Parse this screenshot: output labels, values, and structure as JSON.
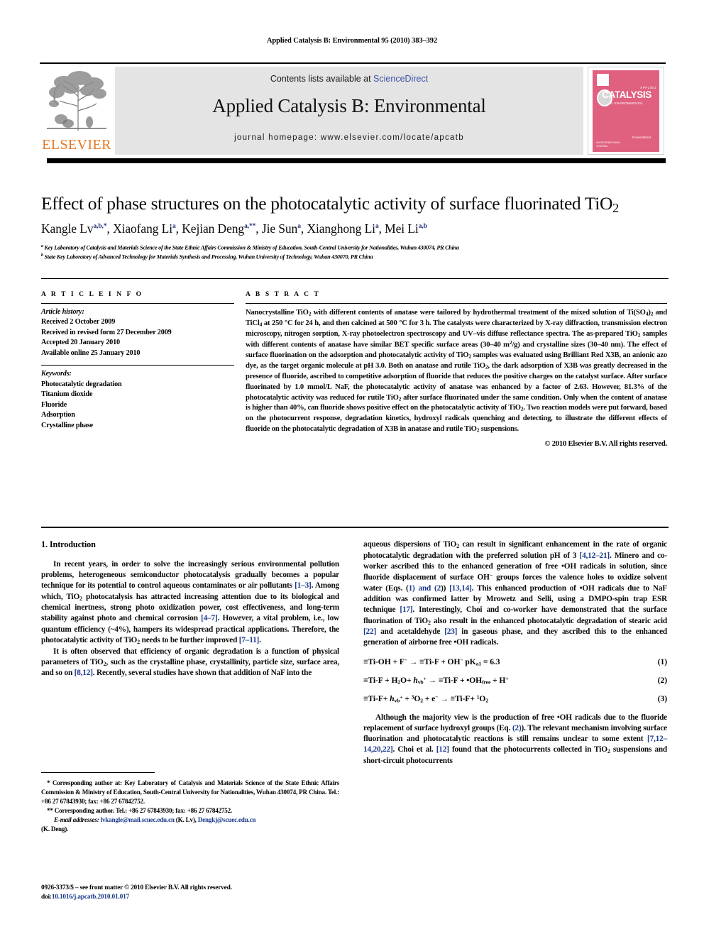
{
  "running_head": "Applied Catalysis B: Environmental 95 (2010) 383–392",
  "masthead": {
    "contents_prefix": "Contents lists available at ",
    "sciencedirect": "ScienceDirect",
    "journal_title": "Applied Catalysis B: Environmental",
    "homepage": "journal homepage: www.elsevier.com/locate/apcatb",
    "publisher_wordmark": "ELSEVIER",
    "cover": {
      "kicker": "APPLIED",
      "title": "CATALYSIS",
      "subtitle": "B: ENVIRONMENTAL",
      "footer": "AN INTERNATIONAL JOURNAL",
      "sd_logo": "ScienceDirect"
    }
  },
  "article": {
    "title": "Effect of phase structures on the photocatalytic activity of surface fluorinated TiO",
    "title_sub": "2",
    "authors": [
      {
        "name": "Kangle Lv",
        "marks": "a,b,*"
      },
      {
        "name": "Xiaofang Li",
        "marks": "a"
      },
      {
        "name": "Kejian Deng",
        "marks": "a,**"
      },
      {
        "name": "Jie Sun",
        "marks": "a"
      },
      {
        "name": "Xianghong Li",
        "marks": "a"
      },
      {
        "name": "Mei Li",
        "marks": "a,b"
      }
    ],
    "affiliations": [
      {
        "mark": "a",
        "text": "Key Laboratory of Catalysis and Materials Science of the State Ethnic Affairs Commission & Ministry of Education, South-Central University for Nationalities, Wuhan 430074, PR China"
      },
      {
        "mark": "b",
        "text": "State Key Laboratory of Advanced Technology for Materials Synthesis and Processing, Wuhan University of Technology, Wuhan 430070, PR China"
      }
    ]
  },
  "article_info": {
    "heading": "A R T I C L E   I N F O",
    "history_label": "Article history:",
    "history": [
      "Received 2 October 2009",
      "Received in revised form 27 December 2009",
      "Accepted 20 January 2010",
      "Available online 25 January 2010"
    ],
    "keywords_label": "Keywords:",
    "keywords": [
      "Photocatalytic degradation",
      "Titanium dioxide",
      "Fluoride",
      "Adsorption",
      "Crystalline phase"
    ]
  },
  "abstract": {
    "heading": "A B S T R A C T",
    "text": "Nanocrystalline TiO2 with different contents of anatase were tailored by hydrothermal treatment of the mixed solution of Ti(SO4)2 and TiCl4 at 250 °C for 24 h, and then calcined at 500 °C for 3 h. The catalysts were characterized by X-ray diffraction, transmission electron microscopy, nitrogen sorption, X-ray photoelectron spectroscopy and UV–vis diffuse reflectance spectra. The as-prepared TiO2 samples with different contents of anatase have similar BET specific surface areas (30–40 m2/g) and crystalline sizes (30–40 nm). The effect of surface fluorination on the adsorption and photocatalytic activity of TiO2 samples was evaluated using Brilliant Red X3B, an anionic azo dye, as the target organic molecule at pH 3.0. Both on anatase and rutile TiO2, the dark adsorption of X3B was greatly decreased in the presence of fluoride, ascribed to competitive adsorption of fluoride that reduces the positive charges on the catalyst surface. After surface fluorinated by 1.0 mmol/L NaF, the photocatalytic activity of anatase was enhanced by a factor of 2.63. However, 81.3% of the photocatalytic activity was reduced for rutile TiO2 after surface fluorinated under the same condition. Only when the content of anatase is higher than 40%, can fluoride shows positive effect on the photocatalytic activity of TiO2. Two reaction models were put forward, based on the photocurrent response, degradation kinetics, hydroxyl radicals quenching and detecting, to illustrate the different effects of fluoride on the photocatalytic degradation of X3B in anatase and rutile TiO2 suspensions.",
    "copyright": "© 2010 Elsevier B.V. All rights reserved."
  },
  "body": {
    "section_heading": "1. Introduction",
    "left_paragraphs": [
      "In recent years, in order to solve the increasingly serious environmental pollution problems, heterogeneous semiconductor photocatalysis gradually becomes a popular technique for its potential to control aqueous contaminates or air pollutants [1–3]. Among which, TiO2 photocatalysis has attracted increasing attention due to its biological and chemical inertness, strong photo oxidization power, cost effectiveness, and long-term stability against photo and chemical corrosion [4–7]. However, a vital problem, i.e., low quantum efficiency (~4%), hampers its widespread practical applications. Therefore, the photocatalytic activity of TiO2 needs to be further improved [7–11].",
      "It is often observed that efficiency of organic degradation is a function of physical parameters of TiO2, such as the crystalline phase, crystallinity, particle size, surface area, and so on [8,12]. Recently, several studies have shown that addition of NaF into the"
    ],
    "right_paragraphs": [
      "aqueous dispersions of TiO2 can result in significant enhancement in the rate of organic photocatalytic degradation with the preferred solution pH of 3 [4,12–21]. Minero and co-worker ascribed this to the enhanced generation of free •OH radicals in solution, since fluoride displacement of surface OH− groups forces the valence holes to oxidize solvent water (Eqs. (1) and (2)) [13,14]. This enhanced production of •OH radicals due to NaF addition was confirmed latter by Mrowetz and Selli, using a DMPO-spin trap ESR technique [17]. Interestingly, Choi and co-worker have demonstrated that the surface fluorination of TiO2 also result in the enhanced photocatalytic degradation of stearic acid [22] and acetaldehyde [23] in gaseous phase, and they ascribed this to the enhanced generation of airborne free •OH radicals.",
      "Although the majority view is the production of free •OH radicals due to the fluoride replacement of surface hydroxyl groups (Eq. (2)). The relevant mechanism involving surface fluorination and photocatalytic reactions is still remains unclear to some extent [7,12–14,20,22]. Choi et al. [12] found that the photocurrents collected in TiO2 suspensions and short-circuit photocurrents"
    ],
    "equations": [
      {
        "number": "(1)",
        "text": "≡Ti-OH + F− → ≡Ti-F + OH−   pKa1 = 6.3"
      },
      {
        "number": "(2)",
        "text": "≡Ti-F + H2O+ hvb+ → ≡Ti-F + •OHfree + H+"
      },
      {
        "number": "(3)",
        "text": "≡Ti-F+ hvb+ + 3O2 + e− → ≡Ti-F+ 1O2"
      }
    ]
  },
  "footnotes": {
    "line1": "* Corresponding author at: Key Laboratory of Catalysis and Materials Science of the State Ethnic Affairs Commission & Ministry of Education, South-Central University for Nationalities, Wuhan 430074, PR China. Tel.: +86 27 67843930; fax: +86 27 67842752.",
    "line2": "** Corresponding author. Tel.: +86 27 67843930; fax: +86 27 67842752.",
    "email_label": "E-mail addresses:",
    "email1": "lvkangle@mail.scuec.edu.cn",
    "email1_who": "(K. Lv),",
    "email2": "Dengkj@scuec.edu.cn",
    "email2_who": "(K. Deng)."
  },
  "issn": {
    "line1": "0926-3373/$ – see front matter © 2010 Elsevier B.V. All rights reserved.",
    "doi_label": "doi:",
    "doi": "10.1016/j.apcatb.2010.01.017"
  },
  "colors": {
    "elsevier_orange": "#E87722",
    "link_blue": "#1c3a8c",
    "sciencedirect_blue": "#3a53a4",
    "cover_pink": "#e0607f",
    "band_gray": "#e4e4e4"
  }
}
